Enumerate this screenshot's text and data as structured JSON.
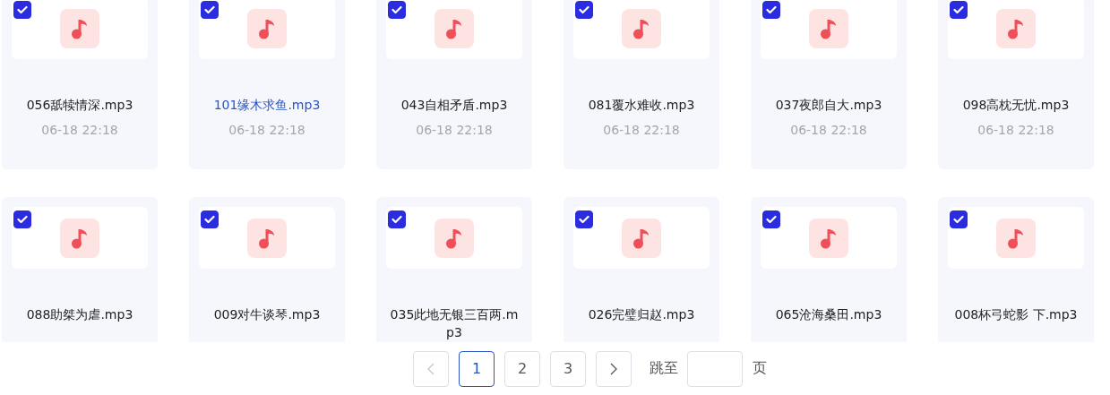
{
  "files": [
    {
      "name": "056舐犊情深.mp3",
      "date": "06-18 22:18",
      "checked": true,
      "selected": false
    },
    {
      "name": "101缘木求鱼.mp3",
      "date": "06-18 22:18",
      "checked": true,
      "selected": true
    },
    {
      "name": "043自相矛盾.mp3",
      "date": "06-18 22:18",
      "checked": true,
      "selected": false
    },
    {
      "name": "081覆水难收.mp3",
      "date": "06-18 22:18",
      "checked": true,
      "selected": false
    },
    {
      "name": "037夜郎自大.mp3",
      "date": "06-18 22:18",
      "checked": true,
      "selected": false
    },
    {
      "name": "098高枕无忧.mp3",
      "date": "06-18 22:18",
      "checked": true,
      "selected": false
    },
    {
      "name": "088助桀为虐.mp3",
      "checked": true,
      "selected": false
    },
    {
      "name": "009对牛谈琴.mp3",
      "checked": true,
      "selected": false
    },
    {
      "name": "035此地无银三百两.mp3",
      "checked": true,
      "selected": false
    },
    {
      "name": "026完璧归赵.mp3",
      "checked": true,
      "selected": false
    },
    {
      "name": "065沧海桑田.mp3",
      "checked": true,
      "selected": false
    },
    {
      "name": "008杯弓蛇影 下.mp3",
      "checked": true,
      "selected": false
    }
  ],
  "pagination": {
    "pages": [
      {
        "label": "1",
        "selected": true
      },
      {
        "label": "2",
        "selected": false
      },
      {
        "label": "3",
        "selected": false
      }
    ],
    "jump_label": "跳至",
    "page_suffix": "页"
  }
}
